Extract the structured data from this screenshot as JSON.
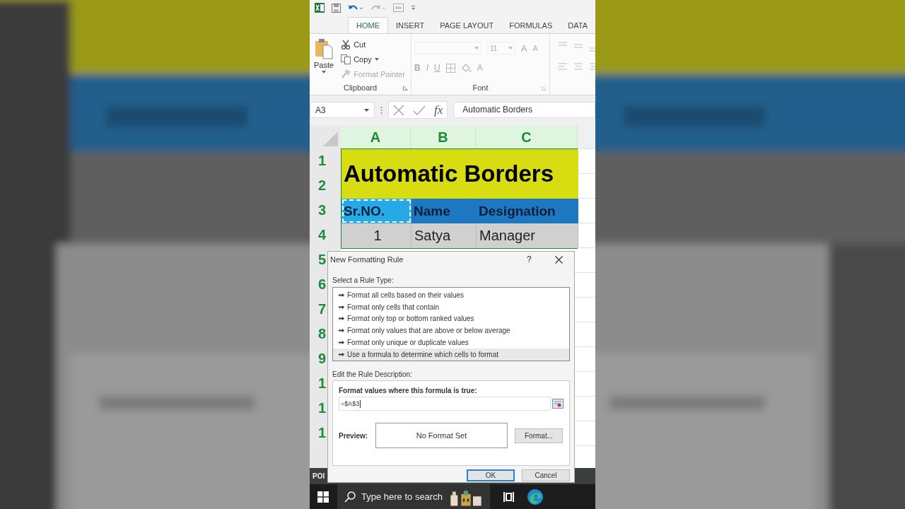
{
  "tabs": [
    {
      "label": "HOME",
      "selected": true
    },
    {
      "label": "INSERT",
      "selected": false
    },
    {
      "label": "PAGE LAYOUT",
      "selected": false
    },
    {
      "label": "FORMULAS",
      "selected": false
    },
    {
      "label": "DATA",
      "selected": false
    }
  ],
  "ribbon": {
    "clipboard": {
      "paste": "Paste",
      "items": [
        {
          "kind": "cut",
          "label": "Cut",
          "disabled": false
        },
        {
          "kind": "copy",
          "label": "Copy",
          "disabled": false
        },
        {
          "kind": "painter",
          "label": "Format Painter",
          "disabled": true
        }
      ],
      "label": "Clipboard"
    },
    "font": {
      "size": "11",
      "grow": "A",
      "shrink": "A",
      "bold": "B",
      "italic": "I",
      "underline": "U",
      "color_button": "A",
      "label": "Font"
    }
  },
  "formula_bar": {
    "name_box": "A3",
    "function_label": "fx",
    "value": "Automatic Borders"
  },
  "sheet": {
    "columns": [
      "A",
      "B",
      "C"
    ],
    "row_numbers": [
      "1",
      "2",
      "3",
      "4",
      "5",
      "6",
      "7",
      "8",
      "9",
      "1",
      "1",
      "1"
    ],
    "title": "Automatic Borders",
    "header_cells": [
      {
        "text": "Sr.NO.",
        "selected": true
      },
      {
        "text": "Name",
        "selected": false
      },
      {
        "text": "Designation",
        "selected": false
      }
    ],
    "data_cells": [
      "1",
      "Satya",
      "Manager"
    ]
  },
  "dialog": {
    "title": "New Formatting Rule",
    "help": "?",
    "select_label": "Select a Rule Type:",
    "rule_types": [
      {
        "label": "Format all cells based on their values",
        "selected": false
      },
      {
        "label": "Format only cells that contain",
        "selected": false
      },
      {
        "label": "Format only top or bottom ranked values",
        "selected": false
      },
      {
        "label": "Format only values that are above or below average",
        "selected": false
      },
      {
        "label": "Format only unique or duplicate values",
        "selected": false
      },
      {
        "label": "Use a formula to determine which cells to format",
        "selected": true
      }
    ],
    "edit_label": "Edit the Rule Description:",
    "formula_label": "Format values where this formula is true:",
    "formula": "=$A$3",
    "preview_label": "Preview:",
    "preview": "No Format Set",
    "format_button": "Format...",
    "buttons": [
      "OK",
      "Cancel"
    ]
  },
  "status_bar": {
    "text": "POI"
  },
  "taskbar": {
    "search_placeholder": "Type here to search"
  }
}
